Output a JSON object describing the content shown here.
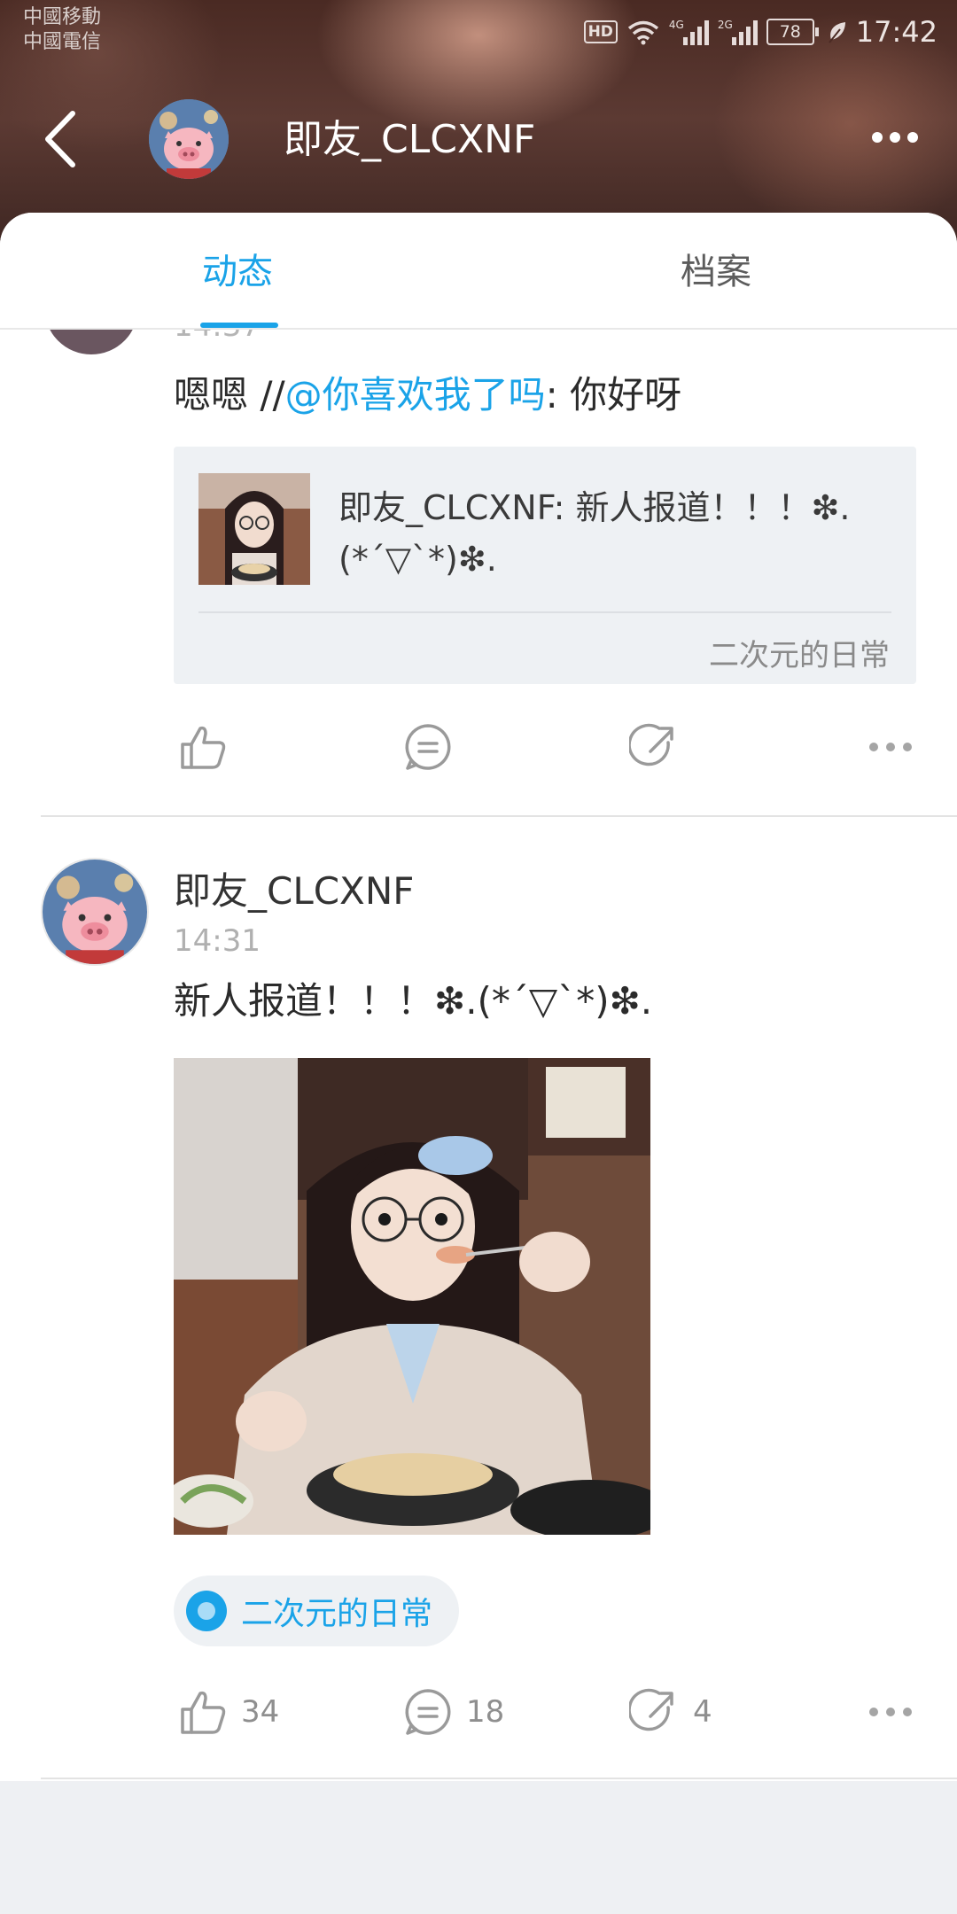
{
  "status_bar": {
    "carrier_1": "中國移動",
    "carrier_2": "中國電信",
    "hd": "HD",
    "network_1": "4G",
    "network_2": "2G",
    "battery": "78",
    "time": "17:42"
  },
  "nav": {
    "title": "即友_CLCXNF",
    "back_icon": "chevron-left-icon",
    "more_icon": "more-horizontal-icon"
  },
  "tabs": [
    {
      "label": "动态",
      "active": true
    },
    {
      "label": "档案",
      "active": false
    }
  ],
  "posts": [
    {
      "time_fragment": "14:37",
      "text_prefix": "嗯嗯 //",
      "mention": "@你喜欢我了吗",
      "text_suffix": ":  你好呀",
      "quote": {
        "text": "即友_CLCXNF: 新人报道！！！❇.(*´▽`*)❇.",
        "topic": "二次元的日常"
      },
      "actions": {
        "like": "",
        "comment": "",
        "repost": ""
      }
    },
    {
      "author": "即友_CLCXNF",
      "time": "14:31",
      "text": "新人报道！！！❇.(*´▽`*)❇.",
      "topic": "二次元的日常",
      "actions": {
        "like": "34",
        "comment": "18",
        "repost": "4"
      }
    }
  ],
  "colors": {
    "accent": "#1aa3e8",
    "background": "#eef0f3",
    "icon_gray": "#8f8f8f"
  }
}
